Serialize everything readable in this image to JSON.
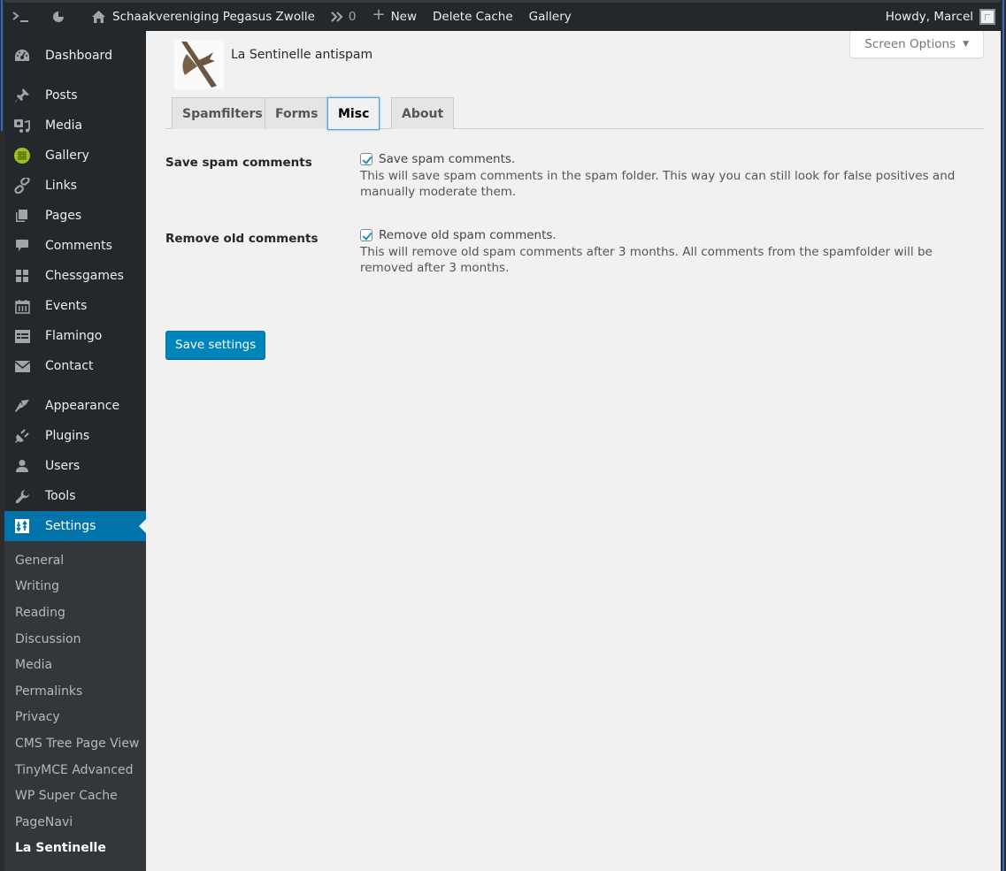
{
  "adminbar": {
    "terminal_icon": "terminal-icon",
    "customize_icon": "pie-chart-icon",
    "site_name": "Schaakvereniging Pegasus Zwolle",
    "updates_count": "0",
    "new_label": "New",
    "delete_cache_label": "Delete Cache",
    "gallery_label": "Gallery",
    "howdy": "Howdy, Marcel"
  },
  "sidebar": {
    "items": [
      {
        "label": "Dashboard",
        "icon": "dashboard-icon"
      },
      {
        "label": "Posts",
        "icon": "pin-icon"
      },
      {
        "label": "Media",
        "icon": "media-icon"
      },
      {
        "label": "Gallery",
        "icon": "gallery-icon"
      },
      {
        "label": "Links",
        "icon": "link-icon"
      },
      {
        "label": "Pages",
        "icon": "pages-icon"
      },
      {
        "label": "Comments",
        "icon": "comment-icon"
      },
      {
        "label": "Chessgames",
        "icon": "grid-icon"
      },
      {
        "label": "Events",
        "icon": "calendar-icon"
      },
      {
        "label": "Flamingo",
        "icon": "list-card-icon"
      },
      {
        "label": "Contact",
        "icon": "mail-icon"
      },
      {
        "label": "Appearance",
        "icon": "brush-icon"
      },
      {
        "label": "Plugins",
        "icon": "plug-icon"
      },
      {
        "label": "Users",
        "icon": "user-icon"
      },
      {
        "label": "Tools",
        "icon": "wrench-icon"
      },
      {
        "label": "Settings",
        "icon": "settings-icon"
      }
    ],
    "submenu": [
      "General",
      "Writing",
      "Reading",
      "Discussion",
      "Media",
      "Permalinks",
      "Privacy",
      "CMS Tree Page View",
      "TinyMCE Advanced",
      "WP Super Cache",
      "PageNavi",
      "La Sentinelle"
    ],
    "accent": "#0073aa"
  },
  "content": {
    "screen_options": "Screen Options",
    "plugin_title": "La Sentinelle antispam",
    "tabs": [
      "Spamfilters",
      "Forms",
      "Misc",
      "About"
    ],
    "active_tab": "Misc",
    "settings": [
      {
        "label": "Save spam comments",
        "checkbox_label": "Save spam comments.",
        "checked": true,
        "description": "This will save spam comments in the spam folder. This way you can still look for false positives and manually moderate them."
      },
      {
        "label": "Remove old comments",
        "checkbox_label": "Remove old spam comments.",
        "checked": true,
        "description": "This will remove old spam comments after 3 months. All comments from the spamfolder will be removed after 3 months."
      }
    ],
    "save_button": "Save settings"
  }
}
